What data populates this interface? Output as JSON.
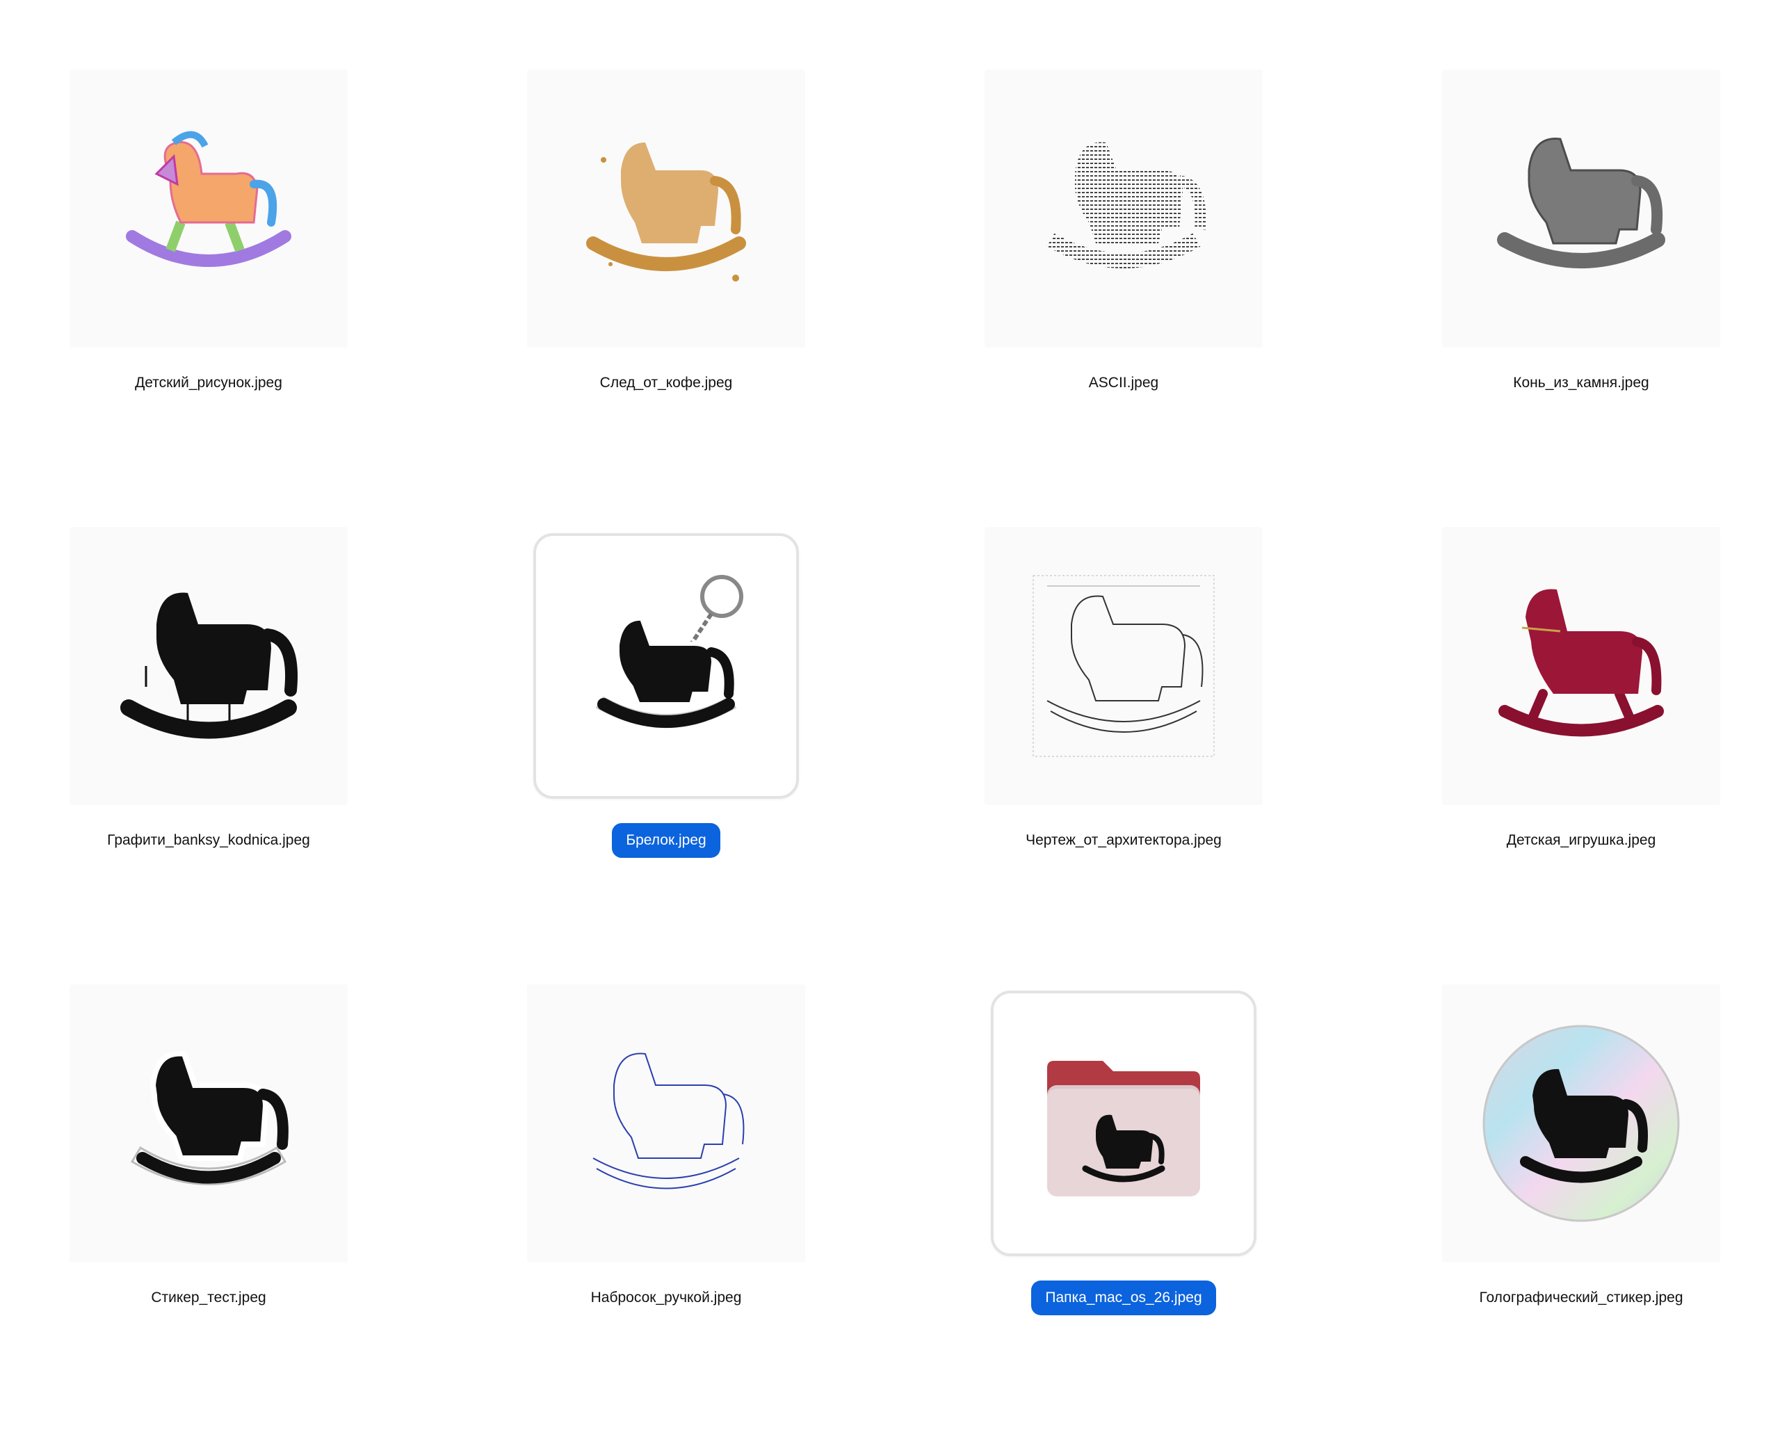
{
  "colors": {
    "selection": "#0b63de",
    "text": "#111111",
    "background": "#ffffff"
  },
  "files": [
    {
      "name": "Детский_рисунок.jpeg",
      "style": "crayon",
      "selected": false
    },
    {
      "name": "След_от_кофе.jpeg",
      "style": "coffee",
      "selected": false
    },
    {
      "name": "ASCII.jpeg",
      "style": "ascii",
      "selected": false
    },
    {
      "name": "Конь_из_камня.jpeg",
      "style": "stone",
      "selected": false
    },
    {
      "name": "Графити_banksy_kodnica.jpeg",
      "style": "graffiti",
      "selected": false
    },
    {
      "name": "Брелок.jpeg",
      "style": "keychain",
      "selected": true
    },
    {
      "name": "Чертеж_от_архитектора.jpeg",
      "style": "blueprint",
      "selected": false
    },
    {
      "name": "Детская_игрушка.jpeg",
      "style": "velvet",
      "selected": false
    },
    {
      "name": "Стикер_тест.jpeg",
      "style": "sticker",
      "selected": false
    },
    {
      "name": "Набросок_ручкой.jpeg",
      "style": "pen",
      "selected": false
    },
    {
      "name": "Папка_mac_os_26.jpeg",
      "style": "folder",
      "selected": true
    },
    {
      "name": "Голографический_стикер.jpeg",
      "style": "holo",
      "selected": false
    }
  ]
}
